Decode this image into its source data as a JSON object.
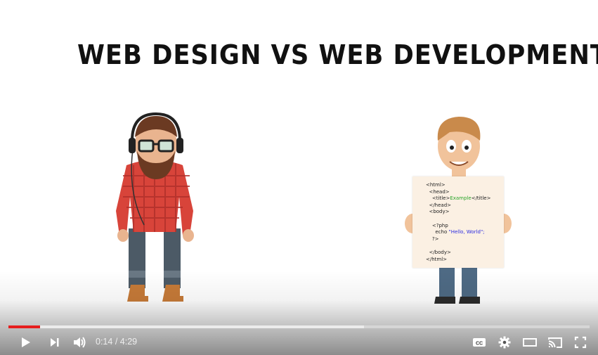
{
  "video": {
    "title_text": "WEB DESIGN VS WEB DEVELOPMENT",
    "code_lines": [
      "<html>",
      "<head>",
      "<title>",
      "Example",
      "</title>",
      "</head>",
      "<body>",
      "<?php",
      "echo",
      "\"Hello, World\";",
      "?>",
      "</body>",
      "</html>"
    ]
  },
  "player": {
    "progress_fraction": 0.054,
    "buffered_fraction": 0.612,
    "progress_color": "#e61e1e",
    "current_time": "0:14",
    "separator": " / ",
    "duration": "4:29",
    "icons": [
      "play-icon",
      "next-icon",
      "volume-icon",
      "captions-icon",
      "settings-icon",
      "theater-mode-icon",
      "cast-icon",
      "fullscreen-icon"
    ]
  }
}
